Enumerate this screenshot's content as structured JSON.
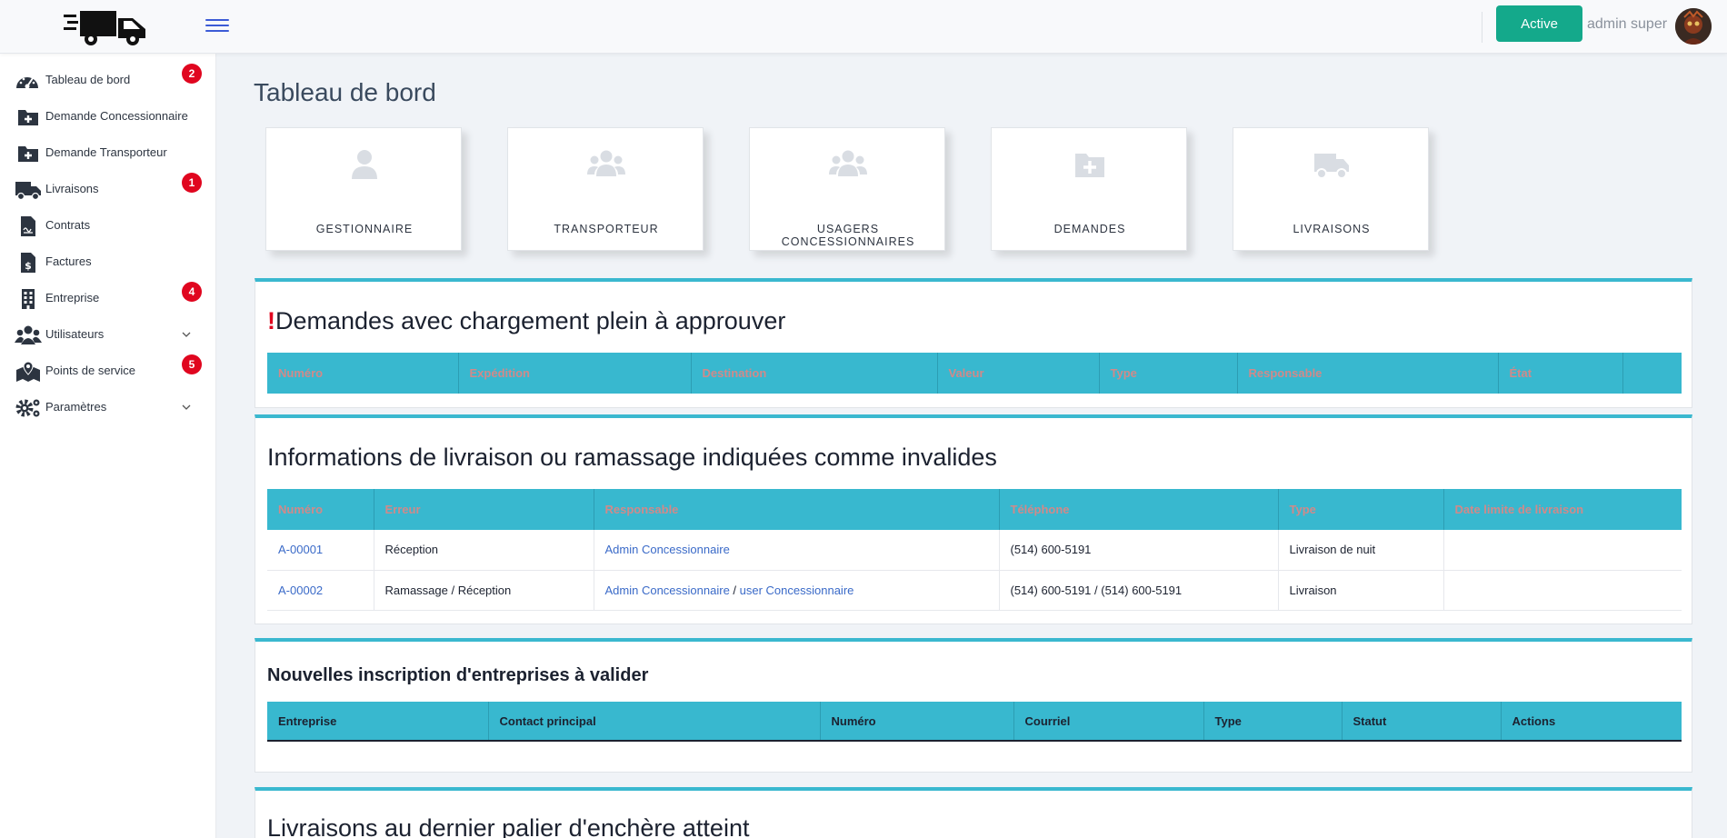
{
  "header": {
    "status_button": "Active",
    "user_name": "admin super"
  },
  "sidebar": {
    "items": [
      {
        "label": "Tableau de bord",
        "icon": "tachometer-icon",
        "badge": "2"
      },
      {
        "label": "Demande Concessionnaire",
        "icon": "folder-plus-icon"
      },
      {
        "label": "Demande Transporteur",
        "icon": "folder-plus-icon"
      },
      {
        "label": "Livraisons",
        "icon": "truck-icon",
        "badge": "1"
      },
      {
        "label": "Contrats",
        "icon": "file-contract-icon"
      },
      {
        "label": "Factures",
        "icon": "file-invoice-dollar-icon"
      },
      {
        "label": "Entreprise",
        "icon": "building-icon",
        "badge": "4"
      },
      {
        "label": "Utilisateurs",
        "icon": "users-icon",
        "expandable": true
      },
      {
        "label": "Points de service",
        "icon": "map-marked-icon",
        "badge": "5"
      },
      {
        "label": "Paramètres",
        "icon": "cogs-icon",
        "expandable": true
      }
    ]
  },
  "page": {
    "title": "Tableau de bord"
  },
  "cards": [
    {
      "label": "GESTIONNAIRE",
      "icon": "user-icon"
    },
    {
      "label": "TRANSPORTEUR",
      "icon": "users-icon"
    },
    {
      "label": "USAGERS CONCESSIONNAIRES",
      "icon": "users-icon"
    },
    {
      "label": "DEMANDES",
      "icon": "folder-plus-icon"
    },
    {
      "label": "LIVRAISONS",
      "icon": "truck-icon"
    }
  ],
  "panel_full_load": {
    "alert_mark": "!",
    "title": "Demandes avec chargement plein à approuver",
    "columns": [
      "Numéro",
      "Expédition",
      "Destination",
      "Valeur",
      "Type",
      "Responsable",
      "État",
      ""
    ]
  },
  "panel_invalid": {
    "title": "Informations de livraison ou ramassage indiquées comme invalides",
    "columns": [
      "Numéro",
      "Erreur",
      "Responsable",
      "Téléphone",
      "Type",
      "Date limite de livraison"
    ],
    "rows": [
      {
        "numero": "A-00001",
        "erreur": "Réception",
        "responsable_1": "Admin Concessionnaire",
        "separator": "",
        "responsable_2": "",
        "telephone": "(514) 600-5191",
        "type": "Livraison de nuit",
        "date_limite": ""
      },
      {
        "numero": "A-00002",
        "erreur": "Ramassage / Réception",
        "responsable_1": "Admin Concessionnaire",
        "separator": " / ",
        "responsable_2": "user Concessionnaire",
        "telephone": "(514) 600-5191 / (514) 600-5191",
        "type": "Livraison",
        "date_limite": ""
      }
    ]
  },
  "panel_registrations": {
    "title": "Nouvelles inscription d'entreprises à valider",
    "columns": [
      "Entreprise",
      "Contact principal",
      "Numéro",
      "Courriel",
      "Type",
      "Statut",
      "Actions"
    ]
  },
  "panel_auction": {
    "title": "Livraisons au dernier palier d'enchère atteint"
  },
  "colors": {
    "accent": "#38b8cf",
    "active_button": "#14a98b",
    "badge": "#e0061f",
    "link": "#3a6ac8"
  }
}
